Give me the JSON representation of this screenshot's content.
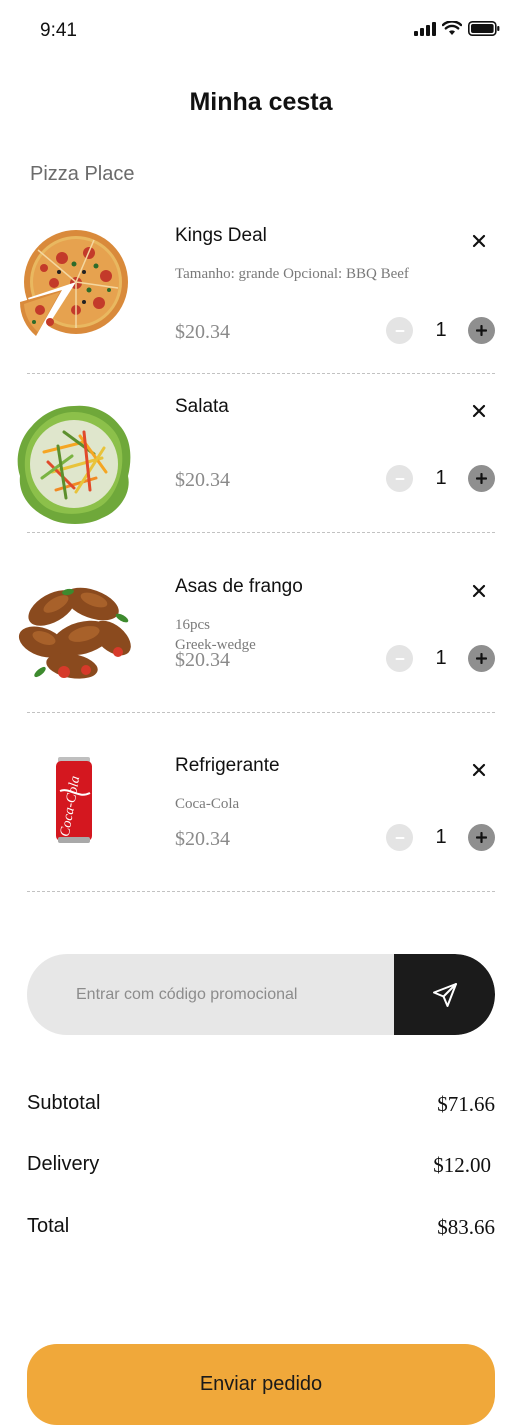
{
  "status_bar": {
    "time": "9:41",
    "icons": [
      "signal-icon",
      "wifi-icon",
      "battery-icon"
    ]
  },
  "header": {
    "title": "Minha cesta"
  },
  "restaurant": {
    "name": "Pizza Place"
  },
  "cart": {
    "items": [
      {
        "name": "Kings Deal",
        "options": "Tamanho: grande   Opcional:  BBQ Beef",
        "price": "$20.34",
        "quantity": "1",
        "image": "pizza-image"
      },
      {
        "name": "Salata",
        "options": "Greek-wedge",
        "price": "$20.34",
        "quantity": "1",
        "image": "salad-image"
      },
      {
        "name": "Asas de frango",
        "options": "16pcs",
        "price": "$20.34",
        "quantity": "1",
        "image": "chicken-wings-image"
      },
      {
        "name": "Refrigerante",
        "options": "Coca-Cola",
        "price": "$20.34",
        "quantity": "1",
        "image": "soda-can-image"
      }
    ],
    "soda_can_text": "Coca-Cola"
  },
  "promo": {
    "placeholder": "Entrar com código promocional",
    "value": ""
  },
  "summary": {
    "subtotal_label": "Subtotal",
    "subtotal_value": "$71.66",
    "delivery_label": "Delivery",
    "delivery_value": "$12.00",
    "total_label": "Total",
    "total_value": "$83.66"
  },
  "submit": {
    "label": "Enviar pedido"
  },
  "colors": {
    "accent": "#f0a83a",
    "send_button": "#1b1b1b",
    "stepper_minus": "#e4e4e4",
    "stepper_plus": "#8f8f8f"
  }
}
